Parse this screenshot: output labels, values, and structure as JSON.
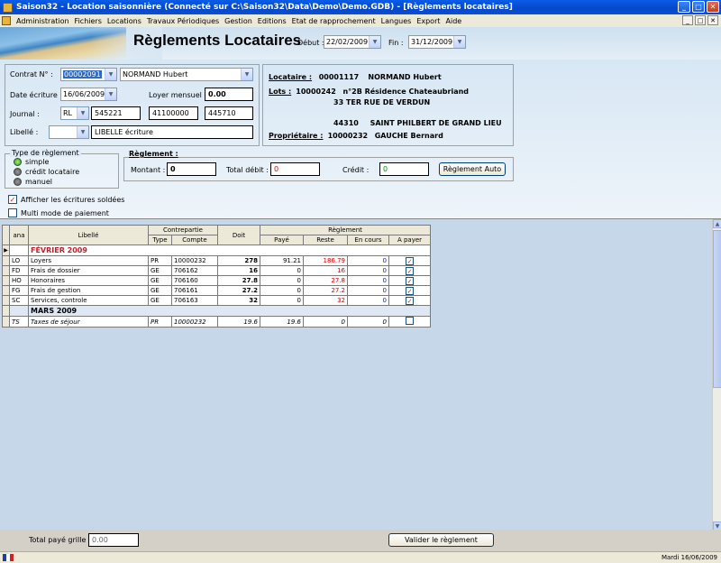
{
  "window": {
    "title": "Saison32 - Location saisonnière (Connecté sur C:\\Saison32\\Data\\Demo\\Demo.GDB) - [Règlements locataires]"
  },
  "menu": [
    "Administration",
    "Fichiers",
    "Locations",
    "Travaux Périodiques",
    "Gestion",
    "Editions",
    "Etat de rapprochement",
    "Langues",
    "Export",
    "Aide"
  ],
  "header": {
    "title": "Règlements Locataires",
    "debut_label": "Début :",
    "debut_value": "22/02/2009",
    "fin_label": "Fin :",
    "fin_value": "31/12/2009"
  },
  "form": {
    "contrat_label": "Contrat N° :",
    "contrat_value": "00002091",
    "contrat_name": "NORMAND Hubert",
    "date_label": "Date écriture :",
    "date_value": "16/06/2009",
    "loyer_label": "Loyer mensuel :",
    "loyer_value": "0.00",
    "journal_label": "Journal :",
    "journal_value": "RL",
    "journal_f1": "545221",
    "journal_f2": "41100000",
    "journal_f3": "445710",
    "libelle_label": "Libellé :",
    "libelle_value": "LIBELLE écriture"
  },
  "locataire": {
    "locataire_label": "Locataire :",
    "locataire_code": "00001117",
    "locataire_name": "NORMAND Hubert",
    "lots_label": "Lots :",
    "lots_code": "10000242",
    "lots_line1": "n°2B Résidence Chateaubriand",
    "lots_line2": "33 TER RUE DE VERDUN",
    "lots_cp": "44310",
    "lots_city": "SAINT PHILBERT DE GRAND LIEU",
    "proprietaire_label": "Propriétaire :",
    "proprietaire_code": "10000232",
    "proprietaire_name": "GAUCHE Bernard"
  },
  "type_reglement": {
    "label": "Type de règlement",
    "options": [
      "simple",
      "crédit locataire",
      "manuel"
    ],
    "selected": 0
  },
  "reglement": {
    "label": "Règlement :",
    "montant_label": "Montant :",
    "montant_value": "0",
    "total_debit_label": "Total débit :",
    "total_debit_value": "0",
    "credit_label": "Crédit :",
    "credit_value": "0",
    "auto_button": "Règlement Auto"
  },
  "options": {
    "afficher_label": "Afficher les écritures soldées",
    "afficher_checked": true,
    "multi_label": "Multi mode de paiement",
    "multi_checked": false
  },
  "grid": {
    "headers": {
      "ana": "ana",
      "libelle": "Libellé",
      "contrepartie": "Contrepartie",
      "type": "Type",
      "compte": "Compte",
      "doit": "Doit",
      "reglement": "Règlement",
      "paye": "Payé",
      "reste": "Reste",
      "en_cours": "En cours",
      "a_payer": "A payer"
    },
    "months": [
      {
        "name": "FÉVRIER 2009",
        "rows": [
          {
            "ana": "LO",
            "libelle": "Loyers",
            "type": "PR",
            "compte": "10000232",
            "doit": "278",
            "paye": "91.21",
            "reste": "186.79",
            "en_cours": "0",
            "checked": true
          },
          {
            "ana": "FD",
            "libelle": "Frais de dossier",
            "type": "GE",
            "compte": "706162",
            "doit": "16",
            "paye": "0",
            "reste": "16",
            "en_cours": "0",
            "checked": true
          },
          {
            "ana": "HO",
            "libelle": "Honoraires",
            "type": "GE",
            "compte": "706160",
            "doit": "27.8",
            "paye": "0",
            "reste": "27.8",
            "en_cours": "0",
            "checked": true
          },
          {
            "ana": "FG",
            "libelle": "Frais de gestion",
            "type": "GE",
            "compte": "706161",
            "doit": "27.2",
            "paye": "0",
            "reste": "27.2",
            "en_cours": "0",
            "checked": true
          },
          {
            "ana": "SC",
            "libelle": "Services, controle",
            "type": "GE",
            "compte": "706163",
            "doit": "32",
            "paye": "0",
            "reste": "32",
            "en_cours": "0",
            "checked": true
          }
        ]
      },
      {
        "name": "MARS 2009",
        "rows": [
          {
            "ana": "TS",
            "libelle": "Taxes de séjour",
            "type": "PR",
            "compte": "10000232",
            "doit": "19.6",
            "paye": "19.6",
            "reste": "0",
            "en_cours": "0",
            "checked": false
          }
        ]
      }
    ]
  },
  "footer": {
    "total_label": "Total payé grille :",
    "total_value": "0.00",
    "valider_button": "Valider le règlement"
  },
  "status": {
    "date": "Mardi 16/06/2009"
  },
  "colors": {
    "titlebar": "#0548c8",
    "accent_red": "#d00000",
    "accent_blue": "#0020d0",
    "grid_bg": "#c5d7e8"
  }
}
